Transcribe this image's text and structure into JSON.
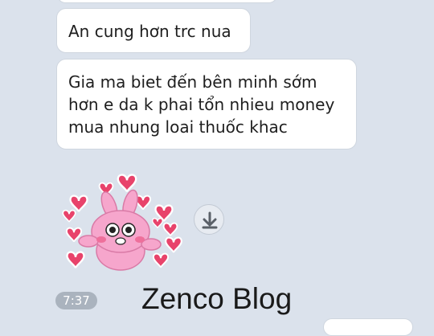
{
  "chat": {
    "messages": [
      {
        "text": "An cung hơn trc nua"
      },
      {
        "lines": [
          "Gia ma biet đến bên minh sớm",
          "hơn e da k phai tổn nhieu money",
          "mua nhung loai thuốc khac"
        ]
      }
    ],
    "sticker": {
      "icon": "pink-bunny-hearts-sticker"
    },
    "download_icon": "download-arrow-icon",
    "timestamp": "7:37"
  },
  "watermark": "Zenco Blog",
  "colors": {
    "background": "#dbe2ec",
    "bubble": "#ffffff",
    "bubble_border": "#cfd6df",
    "time_pill": "#aab3be",
    "heart": "#e8436b",
    "bunny": "#f6a6cc"
  }
}
